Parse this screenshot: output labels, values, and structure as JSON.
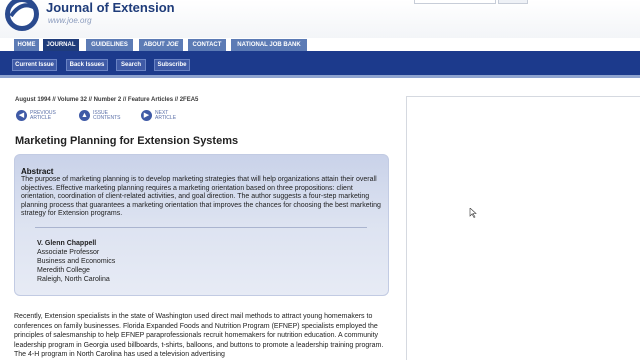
{
  "header": {
    "title": "Journal of Extension",
    "url": "www.joe.org"
  },
  "primary_nav": [
    {
      "label": "HOME",
      "active": false
    },
    {
      "label": "JOURNAL",
      "active": true
    },
    {
      "label": "GUIDELINES",
      "active": false
    },
    {
      "label_prefix": "ABOUT ",
      "label_em": "JOE",
      "active": false
    },
    {
      "label": "CONTACT",
      "active": false
    },
    {
      "label": "NATIONAL JOB BANK",
      "active": false
    }
  ],
  "sub_nav": [
    "Current Issue",
    "Back Issues",
    "Search",
    "Subscribe"
  ],
  "issue_line": "August 1994 // Volume 32 // Number 2 // Feature Articles // 2FEA5",
  "article_nav": {
    "previous": [
      "PREVIOUS",
      "ARTICLE"
    ],
    "contents": [
      "ISSUE",
      "CONTENTS"
    ],
    "next": [
      "NEXT",
      "ARTICLE"
    ]
  },
  "article_title": "Marketing Planning for Extension Systems",
  "abstract": {
    "heading": "Abstract",
    "text": "The purpose of marketing planning is to develop marketing strategies that will help organizations attain their overall objectives. Effective marketing planning requires a marketing orientation based on three propositions: client orientation, coordination of client-related activities, and goal direction. The author suggests a four-step marketing planning process that guarantees a marketing orientation that improves the chances for choosing the best marketing strategy for Extension programs."
  },
  "author": {
    "name": "V. Glenn Chappell",
    "title": "Associate Professor",
    "department": "Business and Economics",
    "institution": "Meredith College",
    "location": "Raleigh, North Carolina"
  },
  "body_text": "Recently, Extension specialists in the state of Washington used direct mail methods to attract young homemakers to conferences on family businesses. Florida Expanded Foods and Nutrition Program (EFNEP) specialists employed the principles of salesmanship to help EFNEP paraprofessionals recruit homemakers for nutrition education. A community leadership program in Georgia used billboards, t-shirts, balloons, and buttons to promote a leadership training program. The 4-H program in North Carolina has used a television advertising"
}
